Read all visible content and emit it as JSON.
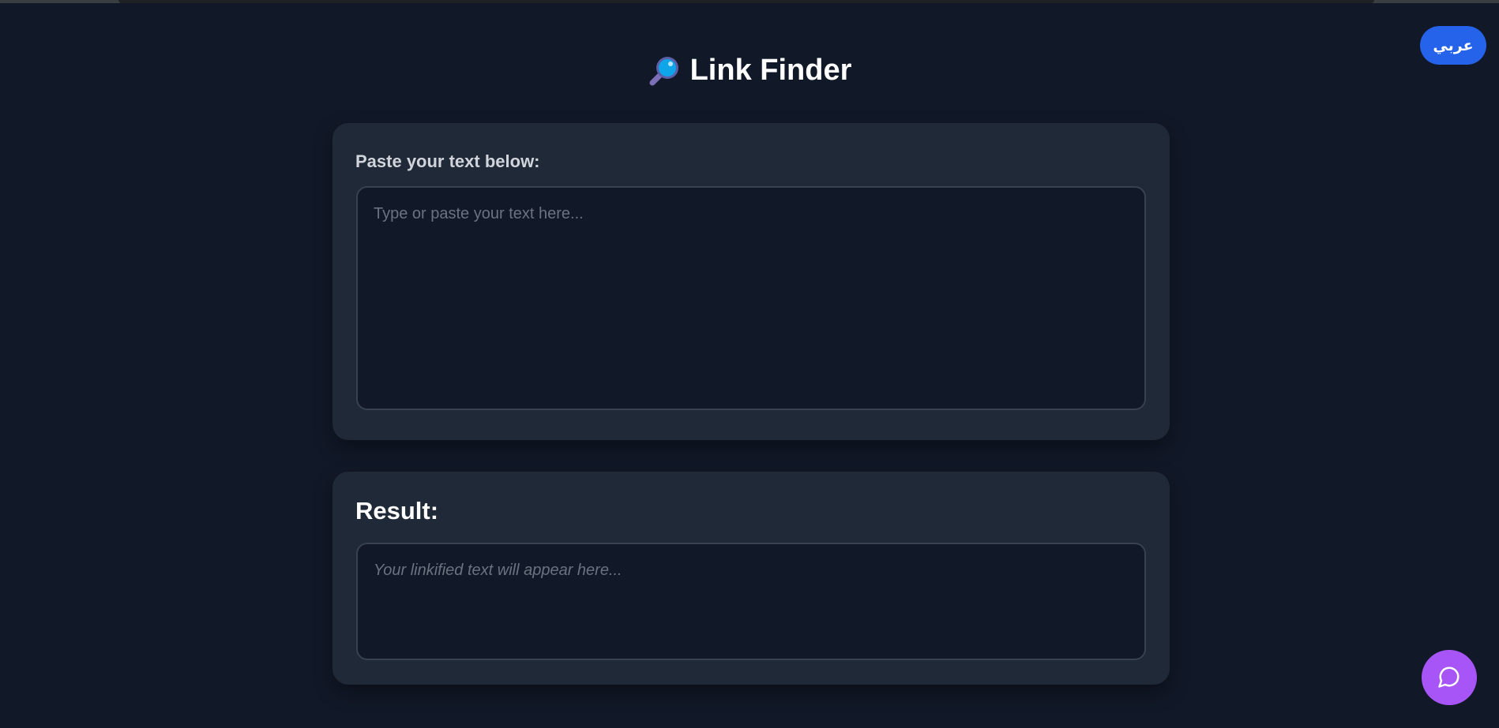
{
  "header": {
    "title": "Link Finder",
    "title_icon": "magnifying-glass-icon",
    "language_button_label": "عربي"
  },
  "input_section": {
    "label": "Paste your text below:",
    "placeholder": "Type or paste your text here...",
    "value": ""
  },
  "result_section": {
    "title": "Result:",
    "placeholder": "Your linkified text will appear here..."
  },
  "chat": {
    "icon": "chat-bubble-icon"
  },
  "colors": {
    "background": "#111827",
    "card": "#1f2937",
    "language_button": "#2563eb",
    "chat_button": "#a855f7",
    "field_border": "#374151"
  }
}
